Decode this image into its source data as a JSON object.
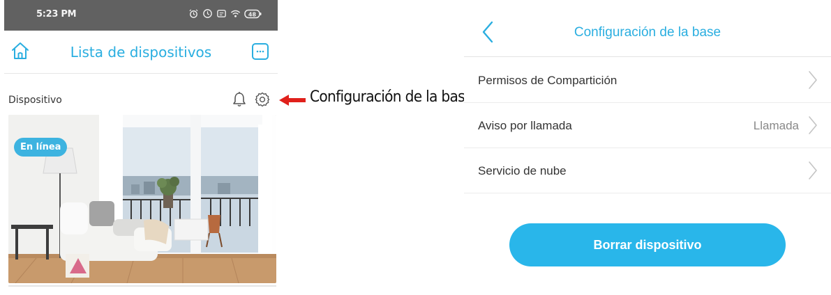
{
  "phone": {
    "status_time": "5:23 PM",
    "status_icons": [
      "alarm-icon",
      "clock-icon",
      "message-icon",
      "wifi-icon",
      "battery-icon"
    ],
    "battery_level": "48",
    "header_title": "Lista de dispositivos",
    "device_label": "Dispositivo",
    "online_badge": "En línea"
  },
  "annotation": {
    "text": "Configuración de la base",
    "arrow_color": "#e0201b"
  },
  "settings": {
    "title": "Configuración de la base",
    "rows": [
      {
        "label": "Permisos de Compartición",
        "value": ""
      },
      {
        "label": "Aviso por llamada",
        "value": "Llamada"
      },
      {
        "label": "Servicio de nube",
        "value": ""
      }
    ],
    "delete_label": "Borrar dispositivo"
  },
  "colors": {
    "accent": "#29aee0",
    "button": "#29b6ea",
    "status_bar": "#616161"
  }
}
